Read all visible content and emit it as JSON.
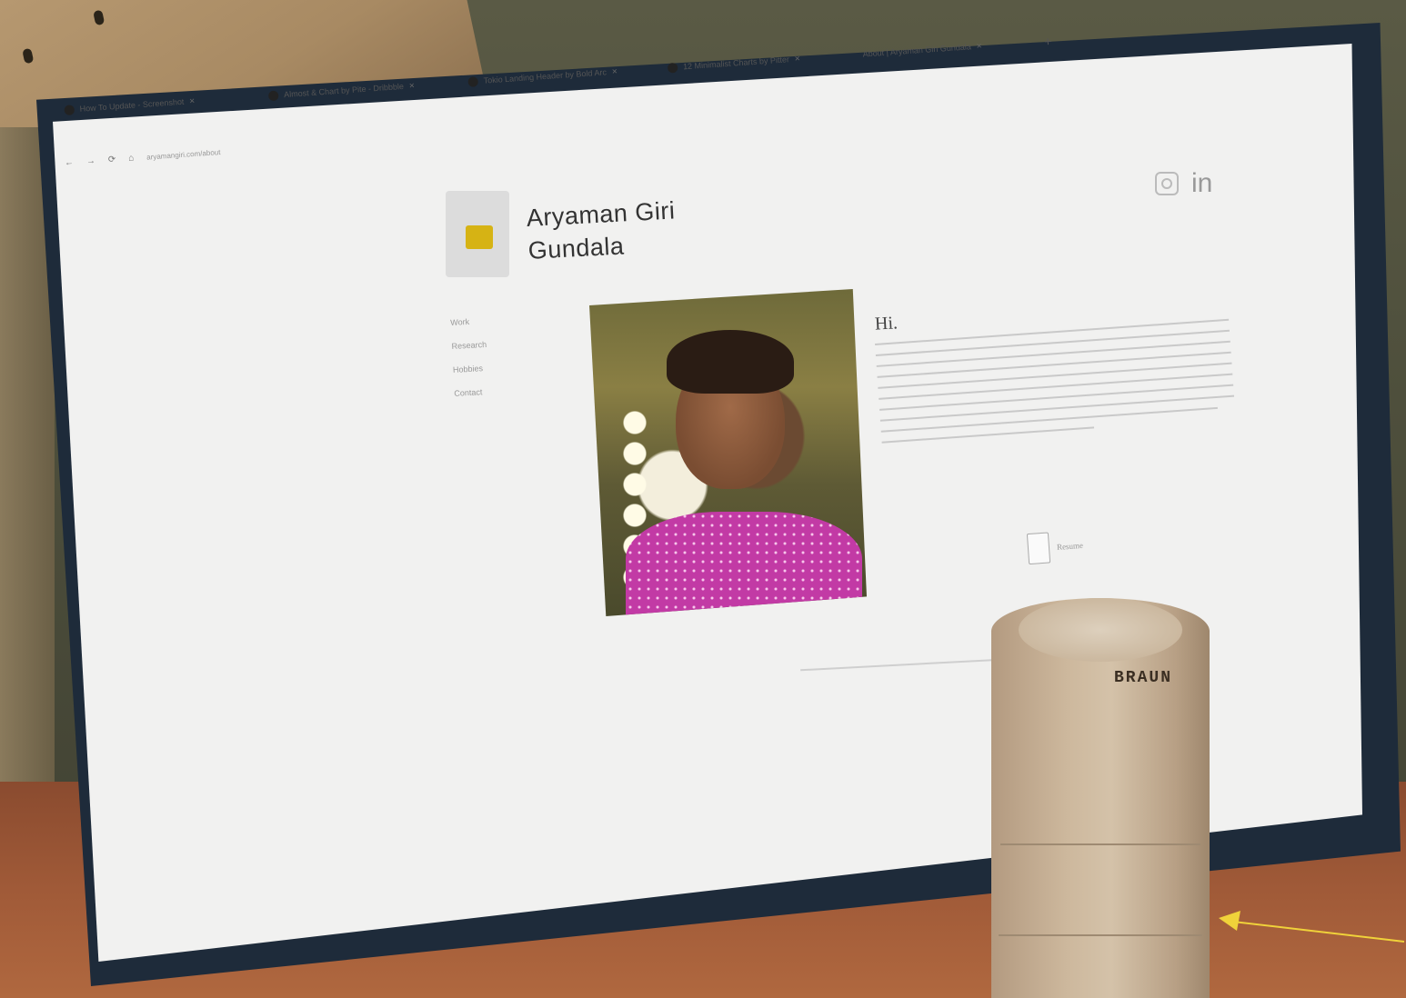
{
  "browser": {
    "tabs": [
      {
        "label": "How To Update - Screenshot"
      },
      {
        "label": "Almost & Chart by Pite - Dribbble"
      },
      {
        "label": "Tokio Landing Header by Bold Arc"
      },
      {
        "label": "12 Minimalist Charts by Pitter"
      },
      {
        "label": "About | Aryaman Giri Gundala"
      }
    ],
    "new_tab": "+",
    "url": "aryamangiri.com/about"
  },
  "site": {
    "name_line1": "Aryaman Giri",
    "name_line2": "Gundala",
    "nav": [
      "Work",
      "Research",
      "Hobbies",
      "Contact"
    ],
    "linkedin": "in",
    "greeting": "Hi.",
    "resume_label": "Resume"
  },
  "object": {
    "brand": "BRAUN"
  },
  "colors": {
    "logo_accent": "#d6b314",
    "shirt": "#c23aa5",
    "annotation_arrow": "#f0d23a"
  }
}
